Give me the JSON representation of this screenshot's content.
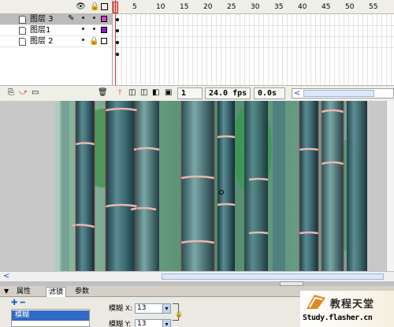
{
  "timeline": {
    "header_icons": [
      "eye-icon",
      "lock-icon",
      "outline-icon"
    ],
    "layers": [
      {
        "name": "图层 3",
        "selected": true,
        "color": "#d040d0",
        "locked": false,
        "editing": true
      },
      {
        "name": "图层1",
        "selected": false,
        "color": "#9020c0",
        "locked": false,
        "editing": false
      },
      {
        "name": "图层 2",
        "selected": false,
        "color": "#ffffff",
        "locked": true,
        "editing": false
      }
    ],
    "ruler_marks": [
      "1",
      "5",
      "10",
      "15",
      "20",
      "25",
      "30",
      "35",
      "40",
      "45",
      "50",
      "55"
    ],
    "current_frame": "1",
    "fps": "24.0 fps",
    "time": "0.0s"
  },
  "properties": {
    "tabs": [
      "属性",
      "滤镜",
      "参数"
    ],
    "active_tab": "滤镜",
    "filter_selected": "模糊",
    "blur_x_label": "模糊 X:",
    "blur_x_value": "13",
    "blur_y_label": "模糊 Y:",
    "blur_y_value": "13"
  },
  "watermark": {
    "title": "教程天堂",
    "url": "Study.flasher.cn"
  },
  "colors": {
    "selected_layer": "#bcbcbc",
    "playhead": "#e03030",
    "filter_highlight": "#316ac5"
  }
}
